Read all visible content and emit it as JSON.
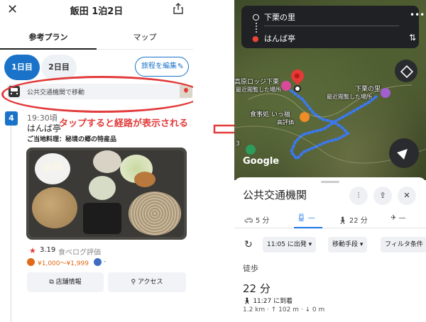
{
  "left": {
    "header": {
      "close": "✕",
      "title": "飯田 1泊2日"
    },
    "tabs": [
      {
        "label": "参考プラン"
      },
      {
        "label": "マップ"
      }
    ],
    "days": [
      {
        "label": "1日目"
      },
      {
        "label": "2日目"
      }
    ],
    "edit_button": "旅程を編集",
    "transit": {
      "label": "公共交通機関で移動"
    },
    "step": {
      "number": "4",
      "time": "19:30頃",
      "place": "はんば亭",
      "note": "ご当地料理：秘境の郷の特産品"
    },
    "rating": {
      "value": "3.19",
      "source": "食べログ評価"
    },
    "price": {
      "range": "¥1,000〜¥1,999",
      "other": "-"
    },
    "buttons": [
      {
        "label": "店舗情報"
      },
      {
        "label": "アクセス"
      }
    ]
  },
  "annotation": "タップすると経路が表示される",
  "right": {
    "search": {
      "from": "下栗の里",
      "to": "はんば亭"
    },
    "map_labels": {
      "lodge": "高原ロッジ下栗",
      "lodge_sub": "最近閲覧した場所",
      "village": "下栗の里",
      "village_sub": "最近閲覧した場所",
      "restaurant": "食事処 いっ福",
      "restaurant_sub": "高評価",
      "google": "Google",
      "num": "3"
    },
    "sheet": {
      "title": "公共交通機関",
      "modes": [
        {
          "label": "5 分"
        },
        {
          "label": "—"
        },
        {
          "label": "22 分"
        },
        {
          "label": "—"
        }
      ],
      "chips": [
        {
          "label": "11:05 に出発 ▾"
        },
        {
          "label": "移動手段 ▾"
        },
        {
          "label": "フィルタ条件"
        }
      ],
      "walk_header": "徒歩",
      "duration": "22 分",
      "arrive": "11:27 に到着",
      "stats": "1.2 km · ↑ 102 m · ↓ 0 m"
    }
  },
  "colors": {
    "accent_blue": "#1a73c8",
    "annotation_red": "#e23b3b",
    "map_dark": "#202124"
  }
}
